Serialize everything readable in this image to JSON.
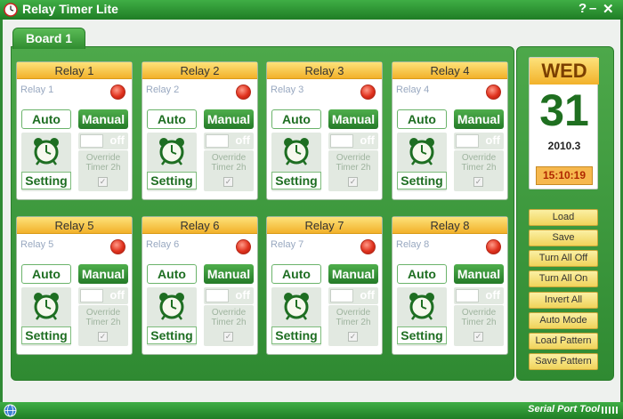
{
  "window": {
    "title": "Relay Timer Lite",
    "help_label": "?",
    "minimize_label": "–",
    "close_label": "✕"
  },
  "board": {
    "tab_label": "Board 1"
  },
  "relay_labels": {
    "auto": "Auto",
    "manual": "Manual",
    "setting": "Setting",
    "toggle": "off",
    "override": "Override Timer 2h",
    "check": "✓"
  },
  "relays": [
    {
      "title": "Relay 1",
      "name": "Relay 1"
    },
    {
      "title": "Relay 2",
      "name": "Relay 2"
    },
    {
      "title": "Relay 3",
      "name": "Relay 3"
    },
    {
      "title": "Relay 4",
      "name": "Relay 4"
    },
    {
      "title": "Relay 5",
      "name": "Relay 5"
    },
    {
      "title": "Relay 6",
      "name": "Relay 6"
    },
    {
      "title": "Relay 7",
      "name": "Relay 7"
    },
    {
      "title": "Relay 8",
      "name": "Relay 8"
    }
  ],
  "calendar": {
    "weekday": "WED",
    "day": "31",
    "year_month": "2010.3",
    "time": "15:10:19"
  },
  "actions": [
    "Load",
    "Save",
    "Turn All Off",
    "Turn All On",
    "Invert All",
    "Auto Mode",
    "Load Pattern",
    "Save Pattern"
  ],
  "statusbar": {
    "text": "Serial Port Tool"
  },
  "colors": {
    "frame": "#2f8a34",
    "header": "#f2b12a",
    "led_off": "#e0321e",
    "button": "#f0d35a"
  }
}
